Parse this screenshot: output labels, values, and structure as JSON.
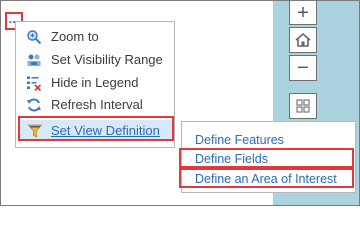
{
  "toolbar": {
    "more_label": "...",
    "more_icon": "ellipsis-icon"
  },
  "context_menu": {
    "items": [
      {
        "label": "Zoom to",
        "icon": "zoom-to-icon"
      },
      {
        "label": "Set Visibility Range",
        "icon": "visibility-range-icon"
      },
      {
        "label": "Hide in Legend",
        "icon": "hide-in-legend-icon"
      },
      {
        "label": "Refresh Interval",
        "icon": "refresh-icon"
      },
      {
        "label": "Set View Definition",
        "icon": "filter-icon",
        "active": true
      }
    ]
  },
  "submenu": {
    "items": [
      {
        "label": "Define Features"
      },
      {
        "label": "Define Fields",
        "highlighted": true
      },
      {
        "label": "Define an Area of Interest",
        "highlighted": true
      }
    ]
  },
  "map_controls": {
    "zoom_in": "+",
    "home_icon": "home-icon",
    "zoom_out": "−",
    "basemap_icon": "grid-icon"
  },
  "colors": {
    "accent": "#2a6cb5",
    "highlight_border": "#e0383b",
    "map_water": "#aad3df",
    "active_row": "#d7e8f7"
  }
}
